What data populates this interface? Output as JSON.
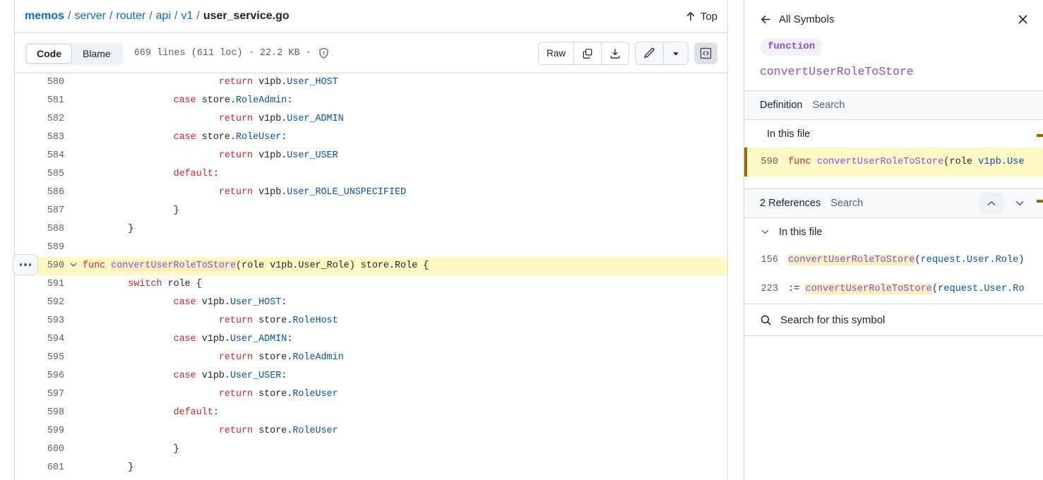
{
  "breadcrumb": {
    "repo": "memos",
    "segments": [
      "server",
      "router",
      "api",
      "v1"
    ],
    "file": "user_service.go",
    "separator": "/"
  },
  "header": {
    "top_label": "Top",
    "top_icon": "arrow-up-icon"
  },
  "toolbar": {
    "code_tab": "Code",
    "blame_tab": "Blame",
    "file_meta": "669 lines (611 loc) · 22.2 KB ·",
    "lines_count": "669 lines (611 loc)",
    "file_size": "22.2 KB",
    "shield_icon": "shield-check-icon",
    "raw_label": "Raw",
    "copy_icon": "copy-icon",
    "download_icon": "download-icon",
    "edit_icon": "pencil-icon",
    "dropdown_icon": "triangle-down-icon",
    "code_view_icon": "code-brackets-icon"
  },
  "code": {
    "highlighted_line": 590,
    "kebab_icon": "kebab-horizontal-icon",
    "fold_icon": "chevron-down-icon",
    "lines": [
      {
        "n": 580,
        "tokens": [
          {
            "t": "                        ",
            "c": "pl"
          },
          {
            "t": "return",
            "c": "k"
          },
          {
            "t": " v1pb.",
            "c": "pl"
          },
          {
            "t": "User_HOST",
            "c": "id"
          }
        ]
      },
      {
        "n": 581,
        "tokens": [
          {
            "t": "                ",
            "c": "pl"
          },
          {
            "t": "case",
            "c": "k"
          },
          {
            "t": " store.",
            "c": "pl"
          },
          {
            "t": "RoleAdmin",
            "c": "id"
          },
          {
            "t": ":",
            "c": "pl"
          }
        ]
      },
      {
        "n": 582,
        "tokens": [
          {
            "t": "                        ",
            "c": "pl"
          },
          {
            "t": "return",
            "c": "k"
          },
          {
            "t": " v1pb.",
            "c": "pl"
          },
          {
            "t": "User_ADMIN",
            "c": "id"
          }
        ]
      },
      {
        "n": 583,
        "tokens": [
          {
            "t": "                ",
            "c": "pl"
          },
          {
            "t": "case",
            "c": "k"
          },
          {
            "t": " store.",
            "c": "pl"
          },
          {
            "t": "RoleUser",
            "c": "id"
          },
          {
            "t": ":",
            "c": "pl"
          }
        ]
      },
      {
        "n": 584,
        "tokens": [
          {
            "t": "                        ",
            "c": "pl"
          },
          {
            "t": "return",
            "c": "k"
          },
          {
            "t": " v1pb.",
            "c": "pl"
          },
          {
            "t": "User_USER",
            "c": "id"
          }
        ]
      },
      {
        "n": 585,
        "tokens": [
          {
            "t": "                ",
            "c": "pl"
          },
          {
            "t": "default",
            "c": "k"
          },
          {
            "t": ":",
            "c": "pl"
          }
        ]
      },
      {
        "n": 586,
        "tokens": [
          {
            "t": "                        ",
            "c": "pl"
          },
          {
            "t": "return",
            "c": "k"
          },
          {
            "t": " v1pb.",
            "c": "pl"
          },
          {
            "t": "User_ROLE_UNSPECIFIED",
            "c": "id"
          }
        ]
      },
      {
        "n": 587,
        "tokens": [
          {
            "t": "                }",
            "c": "pl"
          }
        ]
      },
      {
        "n": 588,
        "tokens": [
          {
            "t": "        }",
            "c": "pl"
          }
        ]
      },
      {
        "n": 589,
        "tokens": [
          {
            "t": "",
            "c": "pl"
          }
        ]
      },
      {
        "n": 590,
        "highlight": true,
        "tokens": [
          {
            "t": "func",
            "c": "k"
          },
          {
            "t": " ",
            "c": "pl"
          },
          {
            "t": "convertUserRoleToStore",
            "c": "fn",
            "symbol": true
          },
          {
            "t": "(role v1pb.User_Role) store.Role {",
            "c": "pl"
          }
        ]
      },
      {
        "n": 591,
        "tokens": [
          {
            "t": "        ",
            "c": "pl"
          },
          {
            "t": "switch",
            "c": "k"
          },
          {
            "t": " role {",
            "c": "pl"
          }
        ]
      },
      {
        "n": 592,
        "tokens": [
          {
            "t": "                ",
            "c": "pl"
          },
          {
            "t": "case",
            "c": "k"
          },
          {
            "t": " v1pb.",
            "c": "pl"
          },
          {
            "t": "User_HOST",
            "c": "id"
          },
          {
            "t": ":",
            "c": "pl"
          }
        ]
      },
      {
        "n": 593,
        "tokens": [
          {
            "t": "                        ",
            "c": "pl"
          },
          {
            "t": "return",
            "c": "k"
          },
          {
            "t": " store.",
            "c": "pl"
          },
          {
            "t": "RoleHost",
            "c": "id"
          }
        ]
      },
      {
        "n": 594,
        "tokens": [
          {
            "t": "                ",
            "c": "pl"
          },
          {
            "t": "case",
            "c": "k"
          },
          {
            "t": " v1pb.",
            "c": "pl"
          },
          {
            "t": "User_ADMIN",
            "c": "id"
          },
          {
            "t": ":",
            "c": "pl"
          }
        ]
      },
      {
        "n": 595,
        "tokens": [
          {
            "t": "                        ",
            "c": "pl"
          },
          {
            "t": "return",
            "c": "k"
          },
          {
            "t": " store.",
            "c": "pl"
          },
          {
            "t": "RoleAdmin",
            "c": "id"
          }
        ]
      },
      {
        "n": 596,
        "tokens": [
          {
            "t": "                ",
            "c": "pl"
          },
          {
            "t": "case",
            "c": "k"
          },
          {
            "t": " v1pb.",
            "c": "pl"
          },
          {
            "t": "User_USER",
            "c": "id"
          },
          {
            "t": ":",
            "c": "pl"
          }
        ]
      },
      {
        "n": 597,
        "tokens": [
          {
            "t": "                        ",
            "c": "pl"
          },
          {
            "t": "return",
            "c": "k"
          },
          {
            "t": " store.",
            "c": "pl"
          },
          {
            "t": "RoleUser",
            "c": "id"
          }
        ]
      },
      {
        "n": 598,
        "tokens": [
          {
            "t": "                ",
            "c": "pl"
          },
          {
            "t": "default",
            "c": "k"
          },
          {
            "t": ":",
            "c": "pl"
          }
        ]
      },
      {
        "n": 599,
        "tokens": [
          {
            "t": "                        ",
            "c": "pl"
          },
          {
            "t": "return",
            "c": "k"
          },
          {
            "t": " store.",
            "c": "pl"
          },
          {
            "t": "RoleUser",
            "c": "id"
          }
        ]
      },
      {
        "n": 600,
        "tokens": [
          {
            "t": "                }",
            "c": "pl"
          }
        ]
      },
      {
        "n": 601,
        "tokens": [
          {
            "t": "        }",
            "c": "pl"
          }
        ]
      }
    ]
  },
  "symbol_panel": {
    "back_label": "All Symbols",
    "back_icon": "arrow-left-icon",
    "close_icon": "x-icon",
    "kind": "function",
    "name": "convertUserRoleToStore",
    "definition": {
      "title": "Definition",
      "search_label": "Search",
      "group_label": "In this file",
      "result": {
        "line": "590",
        "tokens": [
          {
            "t": "func",
            "c": "k"
          },
          {
            "t": " ",
            "c": "pl"
          },
          {
            "t": "convertUserRoleToStore",
            "c": "fn"
          },
          {
            "t": "(role ",
            "c": "pl"
          },
          {
            "t": "v1pb.Use",
            "c": "id"
          }
        ]
      }
    },
    "references": {
      "title": "2 References",
      "search_label": "Search",
      "count": 2,
      "prev_icon": "chevron-up-icon",
      "next_icon": "chevron-down-icon",
      "group_label": "In this file",
      "group_chevron_icon": "chevron-down-icon",
      "results": [
        {
          "line": "156",
          "tokens": [
            {
              "t": "convertUserRoleToStore",
              "c": "fn",
              "symbol": true
            },
            {
              "t": "(",
              "c": "pl"
            },
            {
              "t": "request.User.Role",
              "c": "id"
            },
            {
              "t": ")",
              "c": "pl"
            }
          ]
        },
        {
          "line": "223",
          "tokens": [
            {
              "t": ":= ",
              "c": "pl"
            },
            {
              "t": "convertUserRoleToStore",
              "c": "fn",
              "symbol": true
            },
            {
              "t": "(",
              "c": "pl"
            },
            {
              "t": "request.User.Ro",
              "c": "id"
            }
          ]
        }
      ]
    },
    "search_symbol_label": "Search for this symbol",
    "search_icon": "search-icon"
  },
  "colors": {
    "accent_link": "#0969da",
    "keyword": "#cf222e",
    "identifier": "#0550ae",
    "function": "#8250df",
    "highlight_bg": "#fff8c5",
    "symbol_highlight": "#faeebb",
    "border": "#d1d9e0",
    "muted_text": "#59636e",
    "gold_marker": "#9a6700"
  }
}
